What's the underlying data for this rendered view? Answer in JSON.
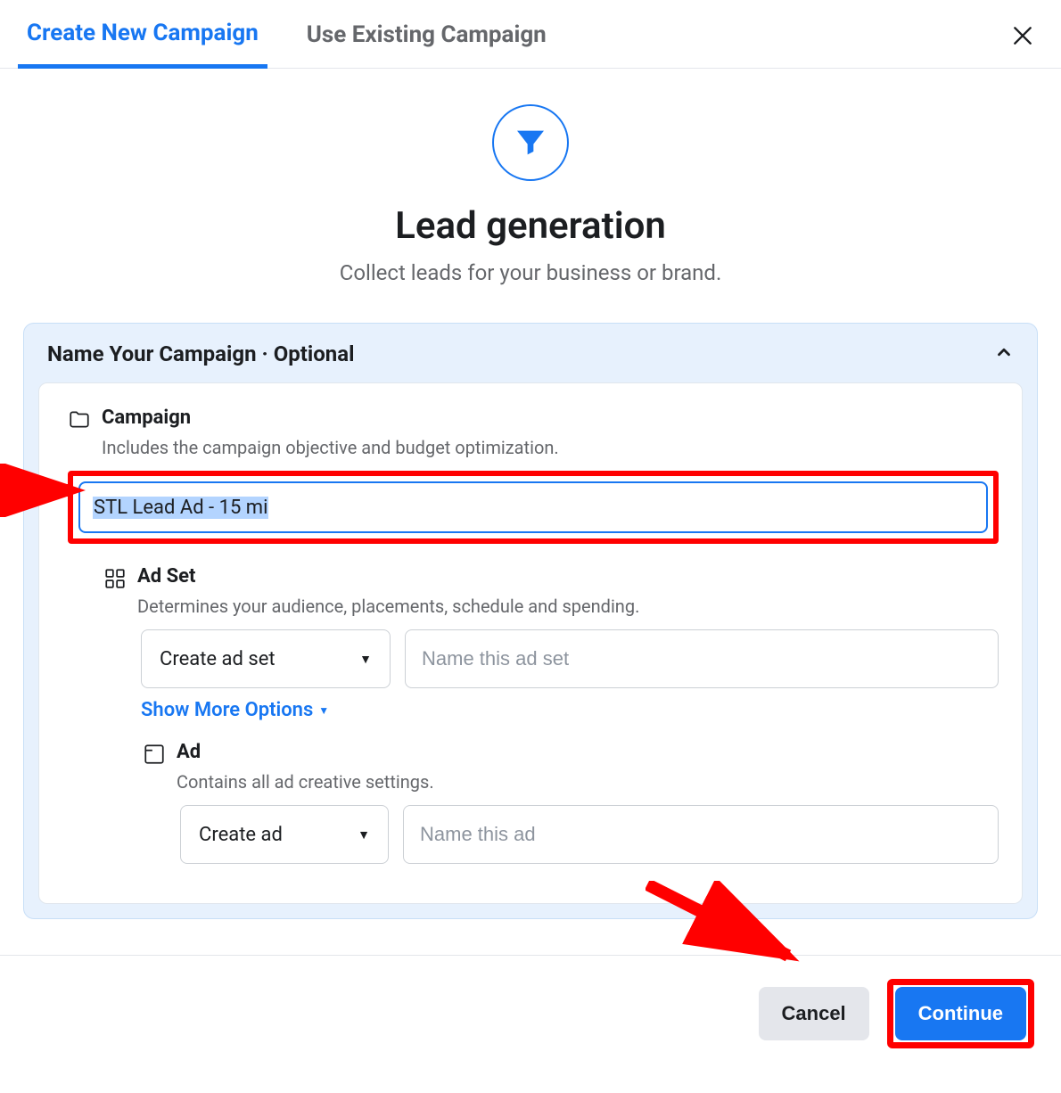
{
  "tabs": {
    "create": "Create New Campaign",
    "existing": "Use Existing Campaign"
  },
  "hero": {
    "title": "Lead generation",
    "subtitle": "Collect leads for your business or brand."
  },
  "section": {
    "header": "Name Your Campaign · Optional"
  },
  "campaign": {
    "label": "Campaign",
    "desc": "Includes the campaign objective and budget optimization.",
    "value": "STL Lead Ad - 15 mi"
  },
  "adset": {
    "label": "Ad Set",
    "desc": "Determines your audience, placements, schedule and spending.",
    "select": "Create ad set",
    "placeholder": "Name this ad set",
    "showmore": "Show More Options"
  },
  "ad": {
    "label": "Ad",
    "desc": "Contains all ad creative settings.",
    "select": "Create ad",
    "placeholder": "Name this ad"
  },
  "footer": {
    "cancel": "Cancel",
    "continue": "Continue"
  }
}
